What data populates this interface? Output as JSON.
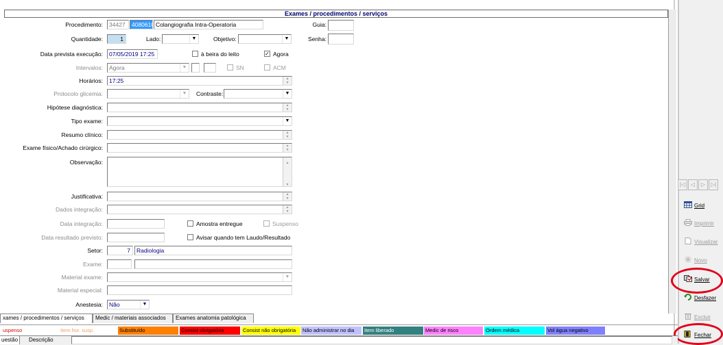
{
  "window": {
    "title": "Exames / procedimentos / serviços"
  },
  "form": {
    "procedimento": {
      "label": "Procedimento:",
      "code1": "34427",
      "code2": "40806103",
      "name": "Colangiografia Intra-Operatoria"
    },
    "guia": {
      "label": "Guia:",
      "value": ""
    },
    "senha": {
      "label": "Senha:",
      "value": ""
    },
    "quantidade": {
      "label": "Quantidade:",
      "value": "1"
    },
    "lado": {
      "label": "Lado:",
      "value": ""
    },
    "objetivo": {
      "label": "Objetivo:",
      "value": ""
    },
    "data_prevista": {
      "label": "Data prevista execução:",
      "value": "07/05/2019 17:25"
    },
    "beira_leito": {
      "label": "à beira do leito",
      "checked": false
    },
    "agora": {
      "label": "Agora",
      "checked": true,
      "check_glyph": "✓"
    },
    "intervalos": {
      "label": "Intervalos:",
      "value": "Agora",
      "sn_label": "SN",
      "acm_label": "ACM"
    },
    "horarios": {
      "label": "Horários:",
      "value": "17:25"
    },
    "protocolo_glicemia": {
      "label": "Protocolo glicemia:",
      "value": ""
    },
    "contraste": {
      "label": "Contraste:",
      "value": ""
    },
    "hipotese": {
      "label": "Hipótese diagnóstica:",
      "value": ""
    },
    "tipo_exame": {
      "label": "Tipo exame:",
      "value": ""
    },
    "resumo_clinico": {
      "label": "Resumo clínico:",
      "value": ""
    },
    "exame_fisico": {
      "label": "Exame físico/Achado cirúrgico:",
      "value": ""
    },
    "observacao": {
      "label": "Observação:",
      "value": ""
    },
    "justificativa": {
      "label": "Justificativa:",
      "value": ""
    },
    "dados_integracao": {
      "label": "Dados integração:",
      "value": ""
    },
    "data_integracao": {
      "label": "Data integração:",
      "value": ""
    },
    "amostra_entregue": {
      "label": "Amostra entregue",
      "checked": false
    },
    "suspenso": {
      "label": "Suspenso",
      "checked": false
    },
    "data_resultado": {
      "label": "Data resultado previsto:",
      "value": ""
    },
    "avisar_laudo": {
      "label": "Avisar quando tem Laudo/Resultado",
      "checked": false
    },
    "setor": {
      "label": "Setor:",
      "code": "7",
      "name": "Radiologia"
    },
    "exame": {
      "label": "Exame:",
      "code": "",
      "name": ""
    },
    "material_exame": {
      "label": "Material exame:",
      "value": ""
    },
    "material_especial": {
      "label": "Material especial:",
      "value": ""
    },
    "anestesia": {
      "label": "Anestesia:",
      "value": "Não"
    }
  },
  "sidebar": {
    "nav": [
      "|◁",
      "◁",
      "▷",
      "▷|"
    ],
    "grid": "Grid",
    "imprimir": "Imprimir",
    "visualizar": "Visualizar",
    "novo": "Novo",
    "salvar": "Salvar",
    "desfazer": "Desfazer",
    "excluir": "Excluir",
    "fechar": "Fechar"
  },
  "tabs": [
    "xames / procedimentos / serviços",
    "Medic / materiais associados",
    "Exames anatomia patológica"
  ],
  "legend": [
    {
      "label": "uspenso",
      "bg": "#ffffff",
      "fg": "#e00000"
    },
    {
      "label": "Item hor. susp.",
      "bg": "#ffffff",
      "fg": "#f0a060"
    },
    {
      "label": "Substituído",
      "bg": "#ff8000",
      "fg": "#000000"
    },
    {
      "label": "Consist obrigatória",
      "bg": "#ff0000",
      "fg": "#000000"
    },
    {
      "label": "Consist não obrigatória",
      "bg": "#ffff00",
      "fg": "#000000"
    },
    {
      "label": "Não administrar no dia",
      "bg": "#c0c0ff",
      "fg": "#000000"
    },
    {
      "label": "Item liberado",
      "bg": "#338080",
      "fg": "#ffffff"
    },
    {
      "label": "Medic de risco",
      "bg": "#ff80ff",
      "fg": "#000000"
    },
    {
      "label": "Ordem médica",
      "bg": "#00ffff",
      "fg": "#000000"
    },
    {
      "label": "Vol água negativo",
      "bg": "#8080ff",
      "fg": "#000000"
    }
  ],
  "bottom_tabs": [
    "uestão",
    "Descrição"
  ],
  "colors": {
    "highlight_circle": "#e0001a",
    "title_text": "#00006e"
  }
}
